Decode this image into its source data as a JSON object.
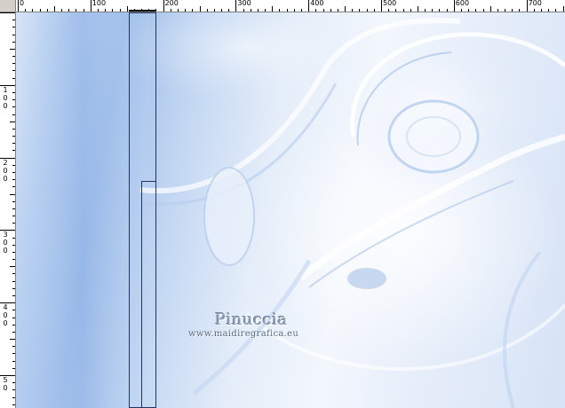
{
  "ruler": {
    "unit": "px",
    "top_labels": [
      "0",
      "100",
      "200",
      "300",
      "400",
      "500",
      "600",
      "700"
    ],
    "left_labels": [
      [
        "1",
        "0",
        "0"
      ],
      [
        "2",
        "0",
        "0"
      ],
      [
        "3",
        "0",
        "0"
      ],
      [
        "4",
        "0",
        "0"
      ],
      [
        "5",
        "0"
      ]
    ]
  },
  "watermark": {
    "name": "Pinuccia",
    "url": "www.maidiregrafica.eu"
  },
  "colors": {
    "workspace": "#d4d0c8",
    "canvas_base": "#c2d6f2",
    "guide": "#1f3560"
  }
}
